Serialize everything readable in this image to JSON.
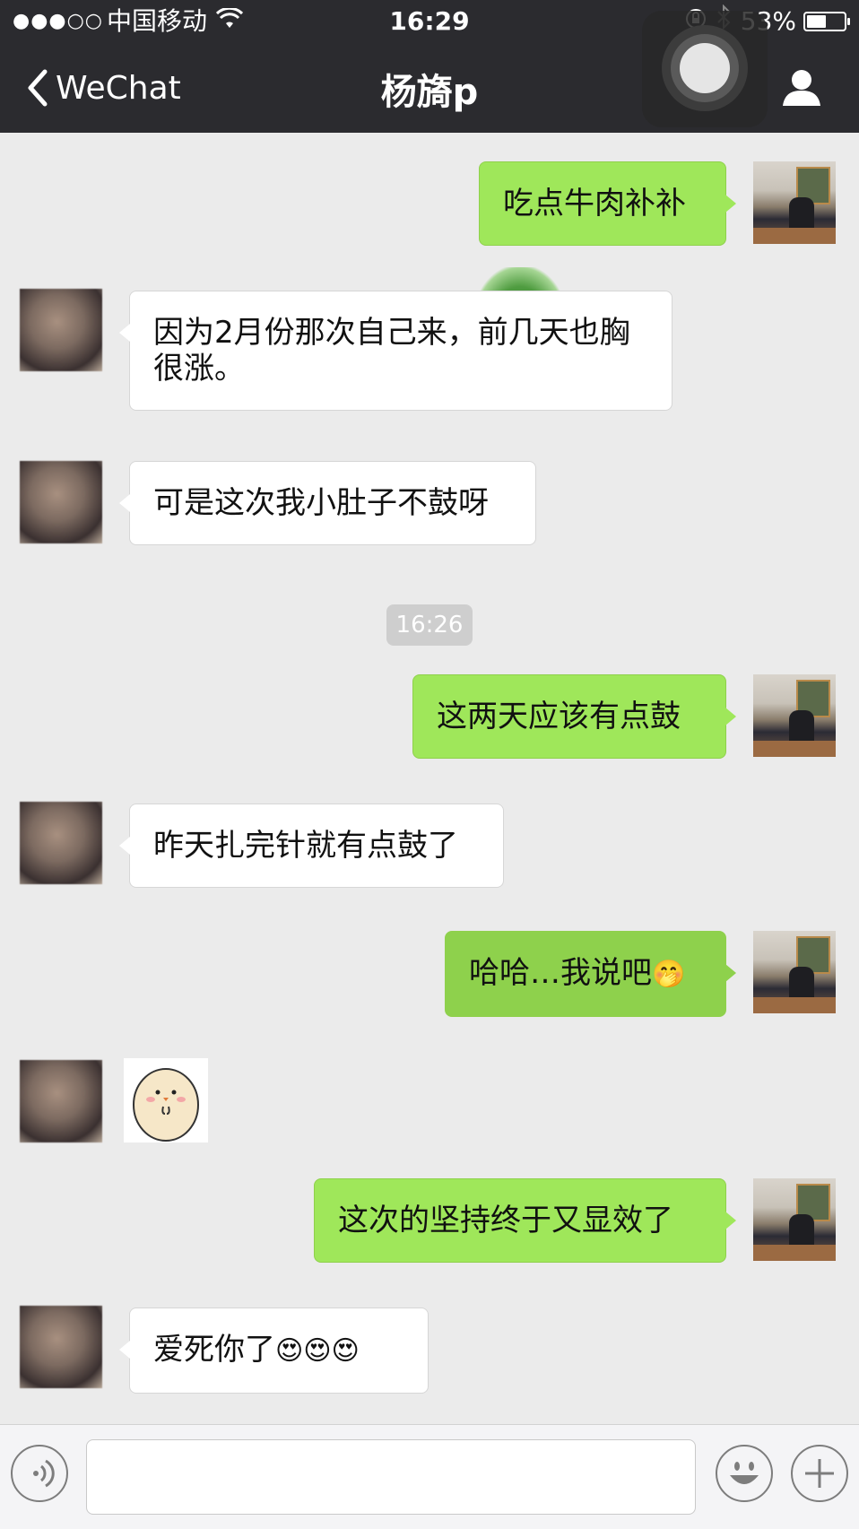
{
  "status_bar": {
    "signal": "●●●○○",
    "carrier": "中国移动",
    "time": "16:29",
    "battery_percent": "53%",
    "battery_level": 0.53
  },
  "nav": {
    "back_label": "WeChat",
    "title": "杨旖p"
  },
  "messages": [
    {
      "from": "me",
      "text": "吃点牛肉补补"
    },
    {
      "from": "them",
      "text": "因为2月份那次自己来，前几天也胸很涨。"
    },
    {
      "from": "them",
      "text": "可是这次我小肚子不鼓呀"
    },
    {
      "type": "timestamp",
      "text": "16:26"
    },
    {
      "from": "me",
      "text": "这两天应该有点鼓"
    },
    {
      "from": "them",
      "text": "昨天扎完针就有点鼓了"
    },
    {
      "from": "me",
      "text": "哈哈…我说吧",
      "emoji": "🤭"
    },
    {
      "from": "them",
      "type": "sticker"
    },
    {
      "from": "me",
      "text": "这次的坚持终于又显效了"
    },
    {
      "from": "them",
      "text": "爱死你了",
      "emoji": "😍😍😍"
    }
  ],
  "input_bar": {
    "input_value": "",
    "voice_icon": "voice-icon",
    "emoji_icon": "emoji-icon",
    "plus_icon": "plus-icon"
  },
  "colors": {
    "topbar": "#2b2b2f",
    "my_bubble": "#9fe75a",
    "their_bubble": "#ffffff",
    "background": "#ebebeb"
  }
}
